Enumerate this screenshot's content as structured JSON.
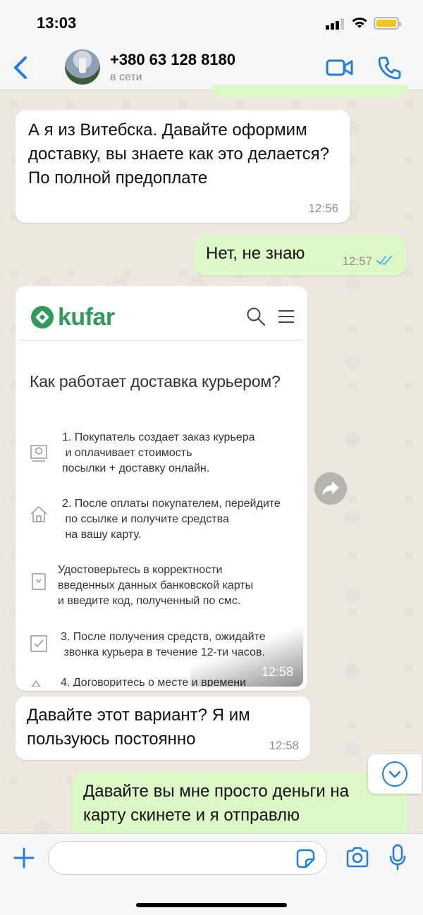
{
  "status_bar": {
    "time": "13:03"
  },
  "header": {
    "contact_name": "+380 63 128 8180",
    "contact_status": "в сети",
    "icons": [
      "chevron-left-icon",
      "video-camera-icon",
      "phone-icon"
    ],
    "accent_color": "#1f7fe0"
  },
  "messages": [
    {
      "direction": "in",
      "text": "А я из Витебска. Давайте оформим доставку, вы знаете как это делается? По полной предоплате",
      "time": "12:56"
    },
    {
      "direction": "out",
      "text": "Нет, не знаю",
      "time": "12:57",
      "status": "read"
    },
    {
      "direction": "in",
      "type": "image",
      "time": "12:58",
      "image": {
        "brand": "kufar",
        "heading": "Как работает доставка курьером?",
        "steps": [
          "1. Покупатель создает заказ курьера и оплачивает стоимость посылки + доставку онлайн.",
          "2. После оплаты покупателем, перейдите по ссылке и получите средства на вашу карту.",
          "Удостоверьтесь в корректности введенных данных банковской карты и введите код, полученный по смс.",
          "3. После получения средств, ожидайте звонка курьера в течение 12-ти часов.",
          "4. Договоритесь о месте и времени"
        ]
      }
    },
    {
      "direction": "in",
      "text": "Давайте этот вариант? Я им пользуюсь постоянно",
      "time": "12:58"
    },
    {
      "direction": "out",
      "text": "Давайте вы мне просто деньги на карту скинете и я отправлю"
    }
  ],
  "colors": {
    "incoming_bubble": "#ffffff",
    "outgoing_bubble": "#dcf8c6",
    "kufar_green": "#2e9a5b"
  },
  "input": {
    "placeholder": "",
    "value": ""
  }
}
